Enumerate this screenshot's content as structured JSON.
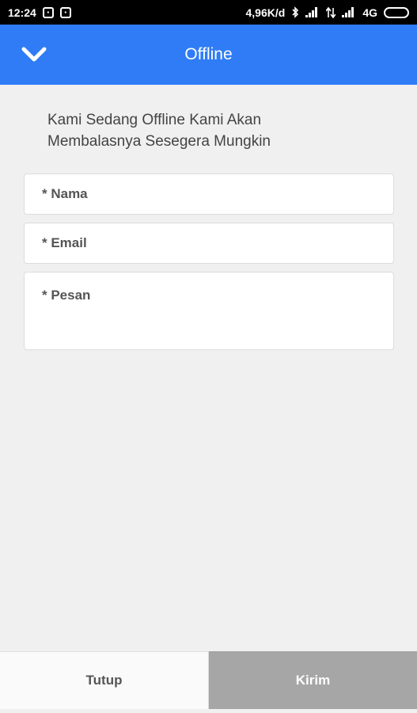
{
  "status_bar": {
    "time": "12:24",
    "network_speed": "4,96K/d",
    "network_type": "4G",
    "icons": [
      "notification-icon",
      "notification-icon",
      "bluetooth-icon",
      "signal-icon",
      "data-transfer-icon",
      "signal-icon",
      "battery-icon"
    ]
  },
  "header": {
    "title": "Offline",
    "collapse_icon": "chevron-down-icon",
    "color": "#2f7cf6"
  },
  "message": {
    "line1": "Kami Sedang Offline Kami Akan",
    "line2": "Membalasnya Sesegera Mungkin"
  },
  "form": {
    "name_placeholder": "* Nama",
    "email_placeholder": "* Email",
    "message_placeholder": "* Pesan"
  },
  "actions": {
    "close_label": "Tutup",
    "send_label": "Kirim"
  }
}
